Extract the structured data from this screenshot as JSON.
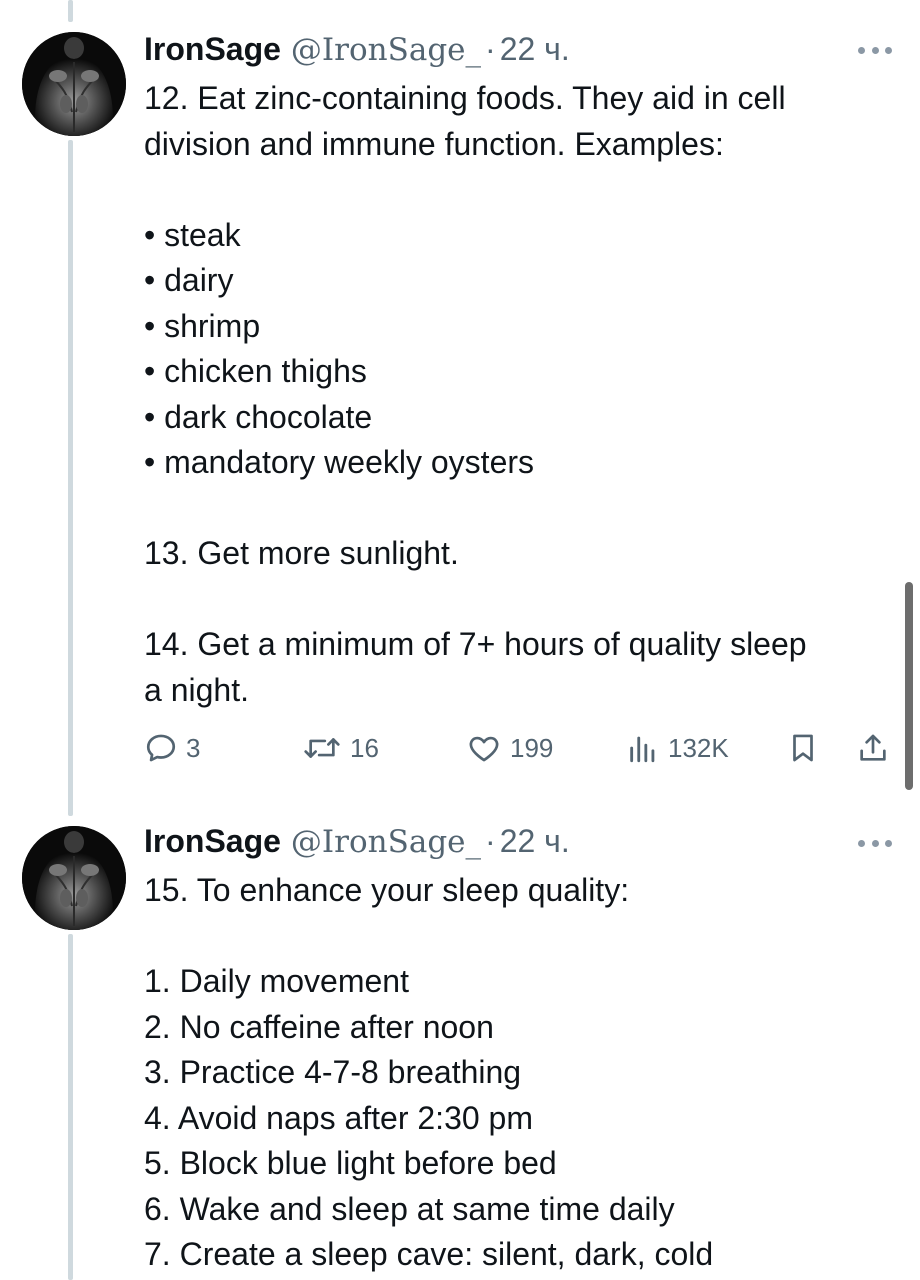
{
  "tweets": [
    {
      "author": {
        "display_name": "IronSage",
        "handle": "@IronSage_",
        "separator": "·",
        "time": "22 ч.",
        "avatar": "muscular-back-photo"
      },
      "lines": [
        "12.  Eat zinc-containing foods. They aid in cell",
        "division and immune function. Examples:",
        "",
        "• steak",
        "• dairy",
        "• shrimp",
        "• chicken thighs",
        "• dark chocolate",
        "• mandatory weekly oysters",
        "",
        "13.  Get more sunlight.",
        "",
        "14.  Get a minimum of 7+ hours of quality sleep",
        "a night."
      ],
      "actions": {
        "replies": "3",
        "retweets": "16",
        "likes": "199",
        "views": "132K",
        "reply_icon": "reply-icon",
        "retweet_icon": "retweet-icon",
        "like_icon": "heart-icon",
        "views_icon": "views-chart-icon",
        "bookmark_icon": "bookmark-icon",
        "share_icon": "share-icon"
      }
    },
    {
      "author": {
        "display_name": "IronSage",
        "handle": "@IronSage_",
        "separator": "·",
        "time": "22 ч.",
        "avatar": "muscular-back-photo"
      },
      "lines": [
        "15.  To enhance your sleep quality:",
        "",
        "1.  Daily movement",
        "2.  No caffeine after noon",
        "3.  Practice 4-7-8 breathing",
        "4.  Avoid naps after 2:30 pm",
        "5.  Block blue light before bed",
        "6.  Wake and sleep at same time daily",
        "7.  Create a sleep cave: silent, dark, cold"
      ]
    }
  ],
  "colors": {
    "text": "#0f1419",
    "secondary": "#536471",
    "thread_line": "#cfd9de",
    "more_dots": "#8b98a5"
  }
}
